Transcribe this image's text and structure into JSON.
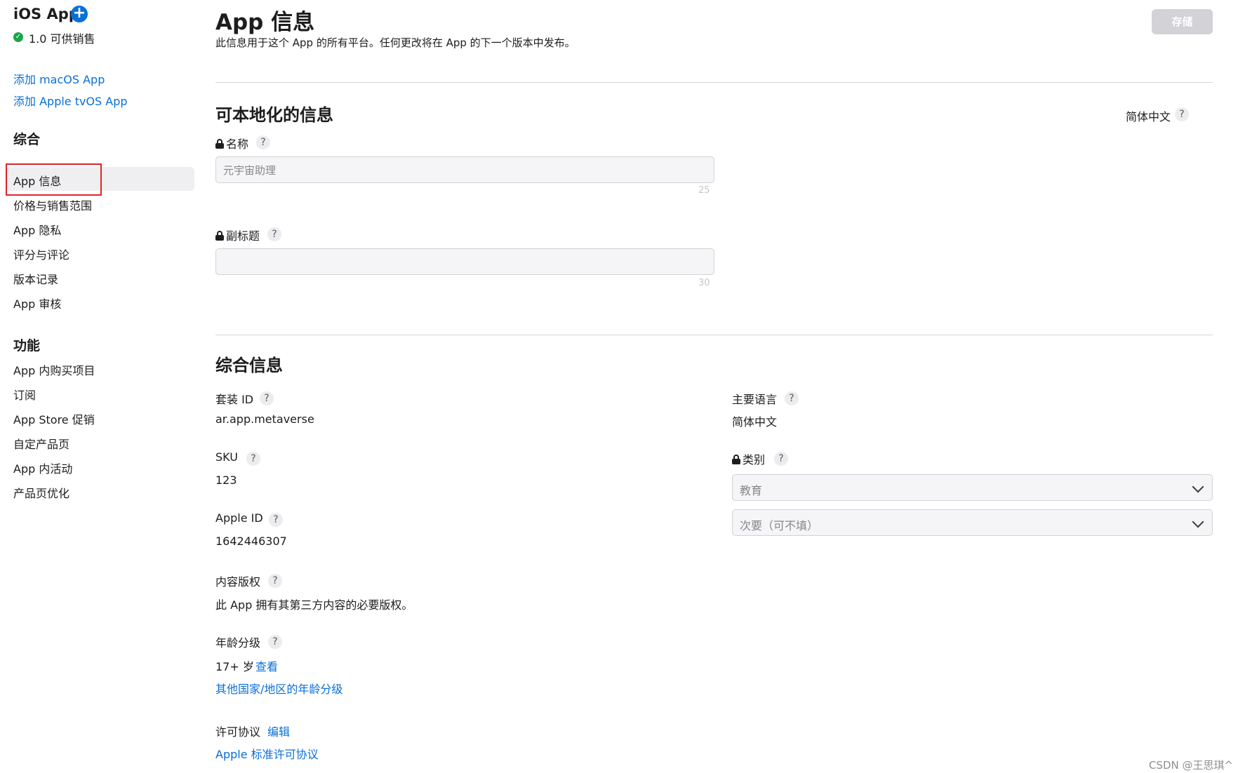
{
  "sidebar": {
    "app_title": "iOS App",
    "status": "1.0 可供销售",
    "add_links": [
      "添加 macOS App",
      "添加 Apple tvOS App"
    ],
    "general_heading": "综合",
    "general_items": [
      "App 信息",
      "价格与销售范围",
      "App 隐私",
      "评分与评论",
      "版本记录",
      "App 审核"
    ],
    "features_heading": "功能",
    "features_items": [
      "App 内购买项目",
      "订阅",
      "App Store 促销",
      "自定产品页",
      "App 内活动",
      "产品页优化"
    ]
  },
  "header": {
    "title": "App 信息",
    "subtitle": "此信息用于这个 App 的所有平台。任何更改将在 App 的下一个版本中发布。",
    "save_label": "存储"
  },
  "localizable": {
    "title": "可本地化的信息",
    "language": "简体中文",
    "name_label": "名称",
    "name_value": "元宇宙助理",
    "name_counter": "25",
    "subtitle_label": "副标题",
    "subtitle_value": "",
    "subtitle_counter": "30"
  },
  "general": {
    "title": "综合信息",
    "bundle_id_label": "套装 ID",
    "bundle_id_value": "ar.app.metaverse",
    "sku_label": "SKU",
    "sku_value": "123",
    "apple_id_label": "Apple ID",
    "apple_id_value": "1642446307",
    "content_rights_label": "内容版权",
    "content_rights_value": "此 App 拥有其第三方内容的必要版权。",
    "age_rating_label": "年龄分级",
    "age_rating_value": "17+ 岁",
    "age_rating_view": "查看",
    "age_rating_other": "其他国家/地区的年龄分级",
    "license_label": "许可协议",
    "license_edit": "编辑",
    "license_value": "Apple 标准许可协议",
    "primary_language_label": "主要语言",
    "primary_language_value": "简体中文",
    "category_label": "类别",
    "category_primary": "教育",
    "category_secondary": "次要（可不填）"
  },
  "help_glyph": "?",
  "watermark": "CSDN @王思琪^",
  "colors": {
    "link_blue": "#0a6fd6",
    "add_button": "#0a6fd6",
    "status_green": "#1aa64a",
    "highlight_red": "#e0242b",
    "save_disabled": "#d2d2d7"
  }
}
